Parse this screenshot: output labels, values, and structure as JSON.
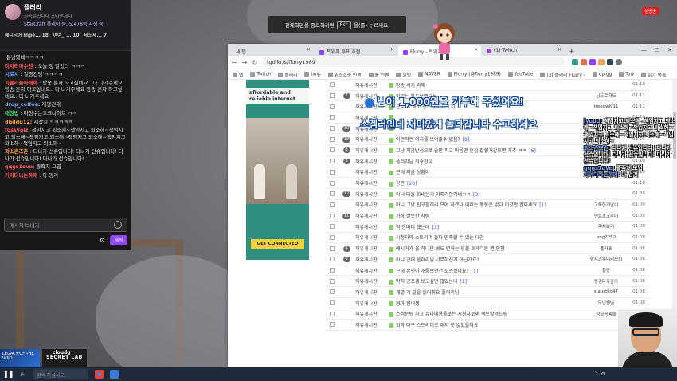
{
  "chat": {
    "channel_name": "플러리",
    "subtitle": "최승렬입니다 스타앤제니",
    "game_line": "StarCraft 플레이 중, 5,478명 시청 중",
    "badges": [
      {
        "label": "해디티어 (nge...",
        "count": "18"
      },
      {
        "label": "여여_(...",
        "count": "10"
      },
      {
        "label": "",
        "count": ""
      },
      {
        "label": "테드재...",
        "count": "7"
      }
    ],
    "messages": [
      {
        "nick": "",
        "color": "#cccccc",
        "text": "봄남였네ㅋㅋㅋㅋ"
      },
      {
        "nick": "미지리아수엔",
        "color": "#ff5a5a",
        "text": ": 오늘 정 말있다 ㅋㅋㅋ"
      },
      {
        "nick": "시로시",
        "color": "#6fa0ff",
        "text": ": 얼짱간텡 ㅋㅋㅋㅋ"
      },
      {
        "nick": "피플리플아매화",
        "color": "#ff5a5a",
        "text": ": 방송 혼자 하고싶네요.. 다 나가주세요방송 혼자 하고싶네요.. 다 나가주세요 방송 혼자 하고싶네요.. 다 나가주세요"
      },
      {
        "nick": "drop_coffee:",
        "color": "#6fa0ff",
        "text": "재명긴해"
      },
      {
        "nick": "대장밥",
        "color": "#4ed06a",
        "text": ": 마청수는코크나이트 ㅋㅋ"
      },
      {
        "nick": "dbddd12:",
        "color": "#ff9a3a",
        "text": "재작일 ㅋㅋㅋㅋㅋ"
      },
      {
        "nick": "fossvoiz:",
        "color": "#ff5a5a",
        "text": "책임지고 퇴소해~책임지고 퇴소해~책임지고 퇴소해~책임지고 퇴소해~책임지고 퇴소해~책임지고 퇴소해~책임지고 퇴소해~"
      },
      {
        "nick": "퇴소즌즈즌",
        "color": "#ff9a3a",
        "text": ": 다나가 선슈입니다! 다나가 선슈입니다! 다나가 선슈입니다! 다나가 선슈입니다!"
      },
      {
        "nick": "gqgs1ove:",
        "color": "#ff5a5a",
        "text": "뜰죽처 오엽"
      },
      {
        "nick": "기야다나는하애",
        "color": "#ff5a5a",
        "text": ": 아 엉겨"
      }
    ],
    "input_placeholder": "메시지 보내기",
    "send_label": "채팅"
  },
  "live_badge": "생방송",
  "fullscreen_notice": {
    "before": "전체화면을 종료하려면",
    "key": "Esc",
    "after": "을(를) 누르세요."
  },
  "browser": {
    "tabs": [
      {
        "label": "새 탭"
      },
      {
        "label": "트위치 후표 추첨"
      },
      {
        "label": "Flurry - 트위치"
      },
      {
        "label": "(1) Twitch"
      }
    ],
    "url": "tgd.kr/s/flurry1989",
    "bookmarks": [
      "앱",
      "Twitch",
      "플러리",
      "twip",
      "워스소중 인팬",
      "를 인팬",
      "일빙",
      "NAVER",
      "Flurry (@flurry1989)",
      "YouTube",
      "(3) 플러리 Flurry -",
      "op.gg",
      "Tow",
      "읽기 목록"
    ]
  },
  "ad": {
    "headline": "affordable and reliable internet",
    "cta": "GET CONNECTED"
  },
  "board": [
    {
      "num": "",
      "cat": "자유게시판",
      "title": "방송 시기 와해",
      "comments": "",
      "author": "",
      "time": "01:10"
    },
    {
      "num": "7",
      "cat": "자유게시판",
      "title": "이거는 화도보면되는",
      "comments": "",
      "author": "님드로하도",
      "time": "01:11"
    },
    {
      "num": "",
      "cat": "자유게시판",
      "title": "근무 그 후고 장소 있나요",
      "comments": "[3]",
      "author": "treeowl911",
      "time": "01:11"
    },
    {
      "num": "",
      "cat": "자유게시판",
      "title": "",
      "comments": "",
      "author": "",
      "time": "01:10"
    },
    {
      "num": "30",
      "cat": "자유게시판",
      "title": "",
      "comments": "",
      "author": "",
      "time": "01:10"
    },
    {
      "num": "18",
      "cat": "자유게시판",
      "title": "이런저런 의치를 보여줄수 없음?",
      "comments": "[8]",
      "author": "",
      "time": "01:10"
    },
    {
      "num": "8",
      "cat": "자유게시판",
      "title": "그냥 지금반성으로 술만 피고 마음면 민심 잡힐거같으면 개추 ㅋㅋ",
      "comments": "[6]",
      "author": "",
      "time": "01:10"
    },
    {
      "num": "8",
      "cat": "자유게시판",
      "title": "플러리님 죄송한데",
      "comments": "",
      "author": "",
      "time": "01:10"
    },
    {
      "num": "",
      "cat": "자유게시판",
      "title": "근데 지금 상황이",
      "comments": "",
      "author": "",
      "time": "01:10"
    },
    {
      "num": "",
      "cat": "자유게시판",
      "title": "공관",
      "comments": "[20]",
      "author": "",
      "time": "01:10"
    },
    {
      "num": "12",
      "cat": "자유게시판",
      "title": "아니 다들 화내는거 이해가안가네ㅋㅋ",
      "comments": "[3]",
      "author": "",
      "time": "01:09"
    },
    {
      "num": "",
      "cat": "자유게시판",
      "title": "아니 그냥 친구들끼리 모여 하겠다 이러는 행동은 없다 이것만 한다세요",
      "comments": "[1]",
      "author": "고독한개날이",
      "time": "01:09"
    },
    {
      "num": "11",
      "cat": "자유게시판",
      "title": "가장 잘못한 사람",
      "comments": "",
      "author": "민트초코우너",
      "time": "01:09"
    },
    {
      "num": "",
      "cat": "자유게시판",
      "title": "딱 한마디 했는데",
      "comments": "[3]",
      "author": "피치보리",
      "time": "01:08"
    },
    {
      "num": "",
      "cat": "자유게시판",
      "title": "시청자와 스트리머 둘다 만족할 수 있는 대안",
      "comments": "",
      "author": "ong2252",
      "time": "01:08"
    },
    {
      "num": "4",
      "cat": "자유게시판",
      "title": "애시거가 올 하나만 봐도 변하는데 볼 트게더든 변 안함",
      "comments": "",
      "author": "플러포",
      "time": "01:08"
    },
    {
      "num": "6",
      "cat": "자유게시판",
      "title": "아니 근데 플러리님 너무하신거 아닌가요?",
      "comments": "",
      "author": "행지즈부대커모퇴",
      "time": "01:08"
    },
    {
      "num": "",
      "cat": "자유게시판",
      "title": "근데 본인이 개를보던건 모르셨나요?",
      "comments": "[1]",
      "author": "플랑",
      "time": "01:08"
    },
    {
      "num": "",
      "cat": "자유게시판",
      "title": "막히 공포겜 보고싶던 많았는데",
      "comments": "[1]",
      "author": "동경다우중아",
      "time": "01:08"
    },
    {
      "num": "",
      "cat": "자유게시판",
      "title": "개발 개 글을 읽어줘요 플러리님",
      "comments": "",
      "author": "slaustkd47",
      "time": "01:08"
    },
    {
      "num": "",
      "cat": "자유게시판",
      "title": "형아 힘내셈",
      "comments": "",
      "author": "모닌원님",
      "time": "01:08"
    },
    {
      "num": "",
      "cat": "자유게시판",
      "title": "스겜눈팅 하고 슈마메용롤보는 시청자로써 팩트말려드림",
      "comments": "",
      "author": "탕모공롱들",
      "time": "01:08"
    },
    {
      "num": "",
      "cat": "자유게시판",
      "title": "퇴막 다쿠 스트리머로 대지 못 없었을까요",
      "comments": "",
      "author": "",
      "time": "01:08"
    }
  ],
  "donation": {
    "text": "님이 1,000원을 기부해 주셨어요!",
    "message": "스겜러인데 재미있게 놀다갑니다 수고하세요"
  },
  "overlay_chat": [
    {
      "nick": "lyouu:",
      "text": "책임지고 퇴소해~책임지고 퇴소해~책임지고 퇴소해~책임지고 퇴소해~책임지고 퇴소해~책임지고 퇴소해~책임지고 퇴소해~"
    },
    {
      "nick": "퇴소즌즈즌:",
      "text": "다나가 선슈입니다! 다나가 선슈입니다! 다나가 선슈입니다! 다나가 선슈입니다!"
    },
    {
      "nick": "gqgs1ove:",
      "text": "뜰죽처 오엽"
    },
    {
      "nick": "기야다나는하애:",
      "text": "아 엉겨"
    }
  ],
  "sponsor": {
    "left": "LEGACY OF THE VOID",
    "right": "SECRET LAB",
    "cloud": "cloudg"
  },
  "taskbar": {
    "search": "검색 하십시오."
  }
}
